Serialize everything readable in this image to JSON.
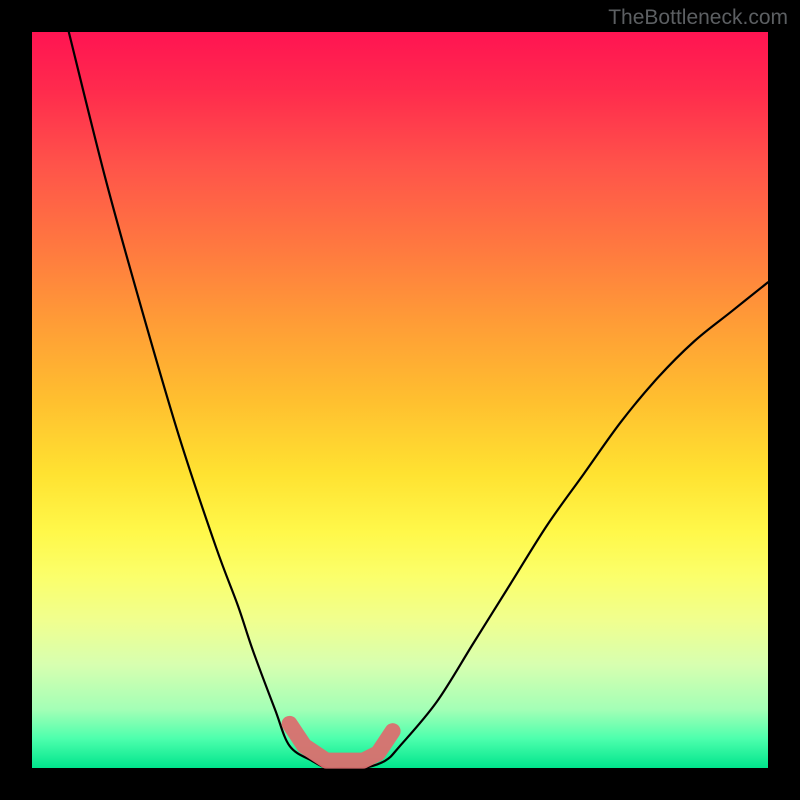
{
  "watermark": "TheBottleneck.com",
  "colors": {
    "background": "#000000",
    "curve": "#000000",
    "marker": "#db6f6f",
    "gradient_top": "#ff1452",
    "gradient_bottom": "#00e58c"
  },
  "chart_data": {
    "type": "line",
    "title": "",
    "xlabel": "",
    "ylabel": "",
    "xlim": [
      0,
      100
    ],
    "ylim": [
      0,
      100
    ],
    "grid": false,
    "legend": false,
    "series": [
      {
        "name": "bottleneck-curve",
        "x": [
          5,
          10,
          15,
          20,
          25,
          28,
          30,
          33,
          35,
          38,
          40,
          42,
          45,
          48,
          50,
          55,
          60,
          65,
          70,
          75,
          80,
          85,
          90,
          95,
          100
        ],
        "values": [
          100,
          80,
          62,
          45,
          30,
          22,
          16,
          8,
          3,
          1,
          0,
          0,
          0,
          1,
          3,
          9,
          17,
          25,
          33,
          40,
          47,
          53,
          58,
          62,
          66
        ]
      }
    ],
    "markers": {
      "name": "highlighted-bottom-segment",
      "x": [
        35,
        37,
        40,
        42,
        45,
        47,
        49
      ],
      "values": [
        6,
        3,
        1,
        1,
        1,
        2,
        5
      ]
    },
    "background_gradient": {
      "orientation": "vertical",
      "stops": [
        {
          "pos": 0.0,
          "color": "#ff1452"
        },
        {
          "pos": 0.3,
          "color": "#ff7b3f"
        },
        {
          "pos": 0.55,
          "color": "#ffe231"
        },
        {
          "pos": 0.8,
          "color": "#f0ff8f"
        },
        {
          "pos": 1.0,
          "color": "#00e58c"
        }
      ]
    }
  }
}
